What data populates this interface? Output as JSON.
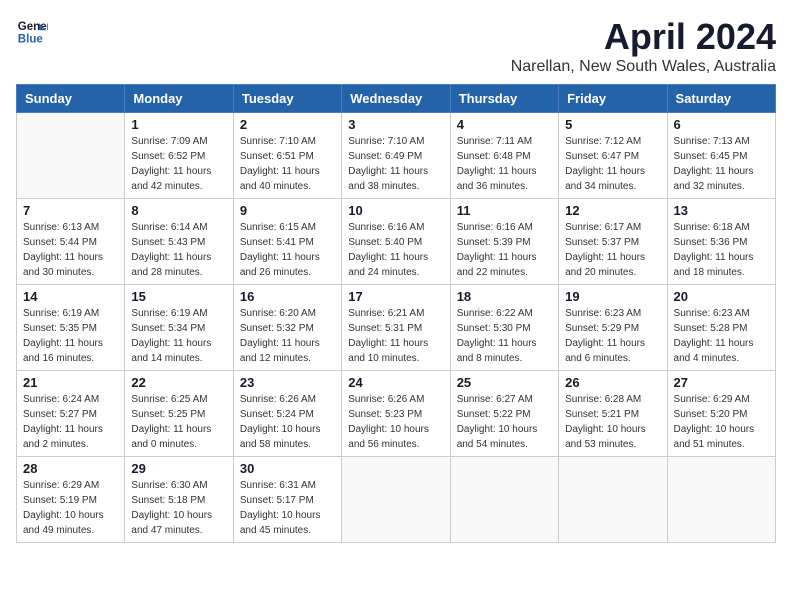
{
  "header": {
    "logo_line1": "General",
    "logo_line2": "Blue",
    "month": "April 2024",
    "location": "Narellan, New South Wales, Australia"
  },
  "weekdays": [
    "Sunday",
    "Monday",
    "Tuesday",
    "Wednesday",
    "Thursday",
    "Friday",
    "Saturday"
  ],
  "weeks": [
    [
      {
        "day": "",
        "info": ""
      },
      {
        "day": "1",
        "info": "Sunrise: 7:09 AM\nSunset: 6:52 PM\nDaylight: 11 hours\nand 42 minutes."
      },
      {
        "day": "2",
        "info": "Sunrise: 7:10 AM\nSunset: 6:51 PM\nDaylight: 11 hours\nand 40 minutes."
      },
      {
        "day": "3",
        "info": "Sunrise: 7:10 AM\nSunset: 6:49 PM\nDaylight: 11 hours\nand 38 minutes."
      },
      {
        "day": "4",
        "info": "Sunrise: 7:11 AM\nSunset: 6:48 PM\nDaylight: 11 hours\nand 36 minutes."
      },
      {
        "day": "5",
        "info": "Sunrise: 7:12 AM\nSunset: 6:47 PM\nDaylight: 11 hours\nand 34 minutes."
      },
      {
        "day": "6",
        "info": "Sunrise: 7:13 AM\nSunset: 6:45 PM\nDaylight: 11 hours\nand 32 minutes."
      }
    ],
    [
      {
        "day": "7",
        "info": "Sunrise: 6:13 AM\nSunset: 5:44 PM\nDaylight: 11 hours\nand 30 minutes."
      },
      {
        "day": "8",
        "info": "Sunrise: 6:14 AM\nSunset: 5:43 PM\nDaylight: 11 hours\nand 28 minutes."
      },
      {
        "day": "9",
        "info": "Sunrise: 6:15 AM\nSunset: 5:41 PM\nDaylight: 11 hours\nand 26 minutes."
      },
      {
        "day": "10",
        "info": "Sunrise: 6:16 AM\nSunset: 5:40 PM\nDaylight: 11 hours\nand 24 minutes."
      },
      {
        "day": "11",
        "info": "Sunrise: 6:16 AM\nSunset: 5:39 PM\nDaylight: 11 hours\nand 22 minutes."
      },
      {
        "day": "12",
        "info": "Sunrise: 6:17 AM\nSunset: 5:37 PM\nDaylight: 11 hours\nand 20 minutes."
      },
      {
        "day": "13",
        "info": "Sunrise: 6:18 AM\nSunset: 5:36 PM\nDaylight: 11 hours\nand 18 minutes."
      }
    ],
    [
      {
        "day": "14",
        "info": "Sunrise: 6:19 AM\nSunset: 5:35 PM\nDaylight: 11 hours\nand 16 minutes."
      },
      {
        "day": "15",
        "info": "Sunrise: 6:19 AM\nSunset: 5:34 PM\nDaylight: 11 hours\nand 14 minutes."
      },
      {
        "day": "16",
        "info": "Sunrise: 6:20 AM\nSunset: 5:32 PM\nDaylight: 11 hours\nand 12 minutes."
      },
      {
        "day": "17",
        "info": "Sunrise: 6:21 AM\nSunset: 5:31 PM\nDaylight: 11 hours\nand 10 minutes."
      },
      {
        "day": "18",
        "info": "Sunrise: 6:22 AM\nSunset: 5:30 PM\nDaylight: 11 hours\nand 8 minutes."
      },
      {
        "day": "19",
        "info": "Sunrise: 6:23 AM\nSunset: 5:29 PM\nDaylight: 11 hours\nand 6 minutes."
      },
      {
        "day": "20",
        "info": "Sunrise: 6:23 AM\nSunset: 5:28 PM\nDaylight: 11 hours\nand 4 minutes."
      }
    ],
    [
      {
        "day": "21",
        "info": "Sunrise: 6:24 AM\nSunset: 5:27 PM\nDaylight: 11 hours\nand 2 minutes."
      },
      {
        "day": "22",
        "info": "Sunrise: 6:25 AM\nSunset: 5:25 PM\nDaylight: 11 hours\nand 0 minutes."
      },
      {
        "day": "23",
        "info": "Sunrise: 6:26 AM\nSunset: 5:24 PM\nDaylight: 10 hours\nand 58 minutes."
      },
      {
        "day": "24",
        "info": "Sunrise: 6:26 AM\nSunset: 5:23 PM\nDaylight: 10 hours\nand 56 minutes."
      },
      {
        "day": "25",
        "info": "Sunrise: 6:27 AM\nSunset: 5:22 PM\nDaylight: 10 hours\nand 54 minutes."
      },
      {
        "day": "26",
        "info": "Sunrise: 6:28 AM\nSunset: 5:21 PM\nDaylight: 10 hours\nand 53 minutes."
      },
      {
        "day": "27",
        "info": "Sunrise: 6:29 AM\nSunset: 5:20 PM\nDaylight: 10 hours\nand 51 minutes."
      }
    ],
    [
      {
        "day": "28",
        "info": "Sunrise: 6:29 AM\nSunset: 5:19 PM\nDaylight: 10 hours\nand 49 minutes."
      },
      {
        "day": "29",
        "info": "Sunrise: 6:30 AM\nSunset: 5:18 PM\nDaylight: 10 hours\nand 47 minutes."
      },
      {
        "day": "30",
        "info": "Sunrise: 6:31 AM\nSunset: 5:17 PM\nDaylight: 10 hours\nand 45 minutes."
      },
      {
        "day": "",
        "info": ""
      },
      {
        "day": "",
        "info": ""
      },
      {
        "day": "",
        "info": ""
      },
      {
        "day": "",
        "info": ""
      }
    ]
  ]
}
